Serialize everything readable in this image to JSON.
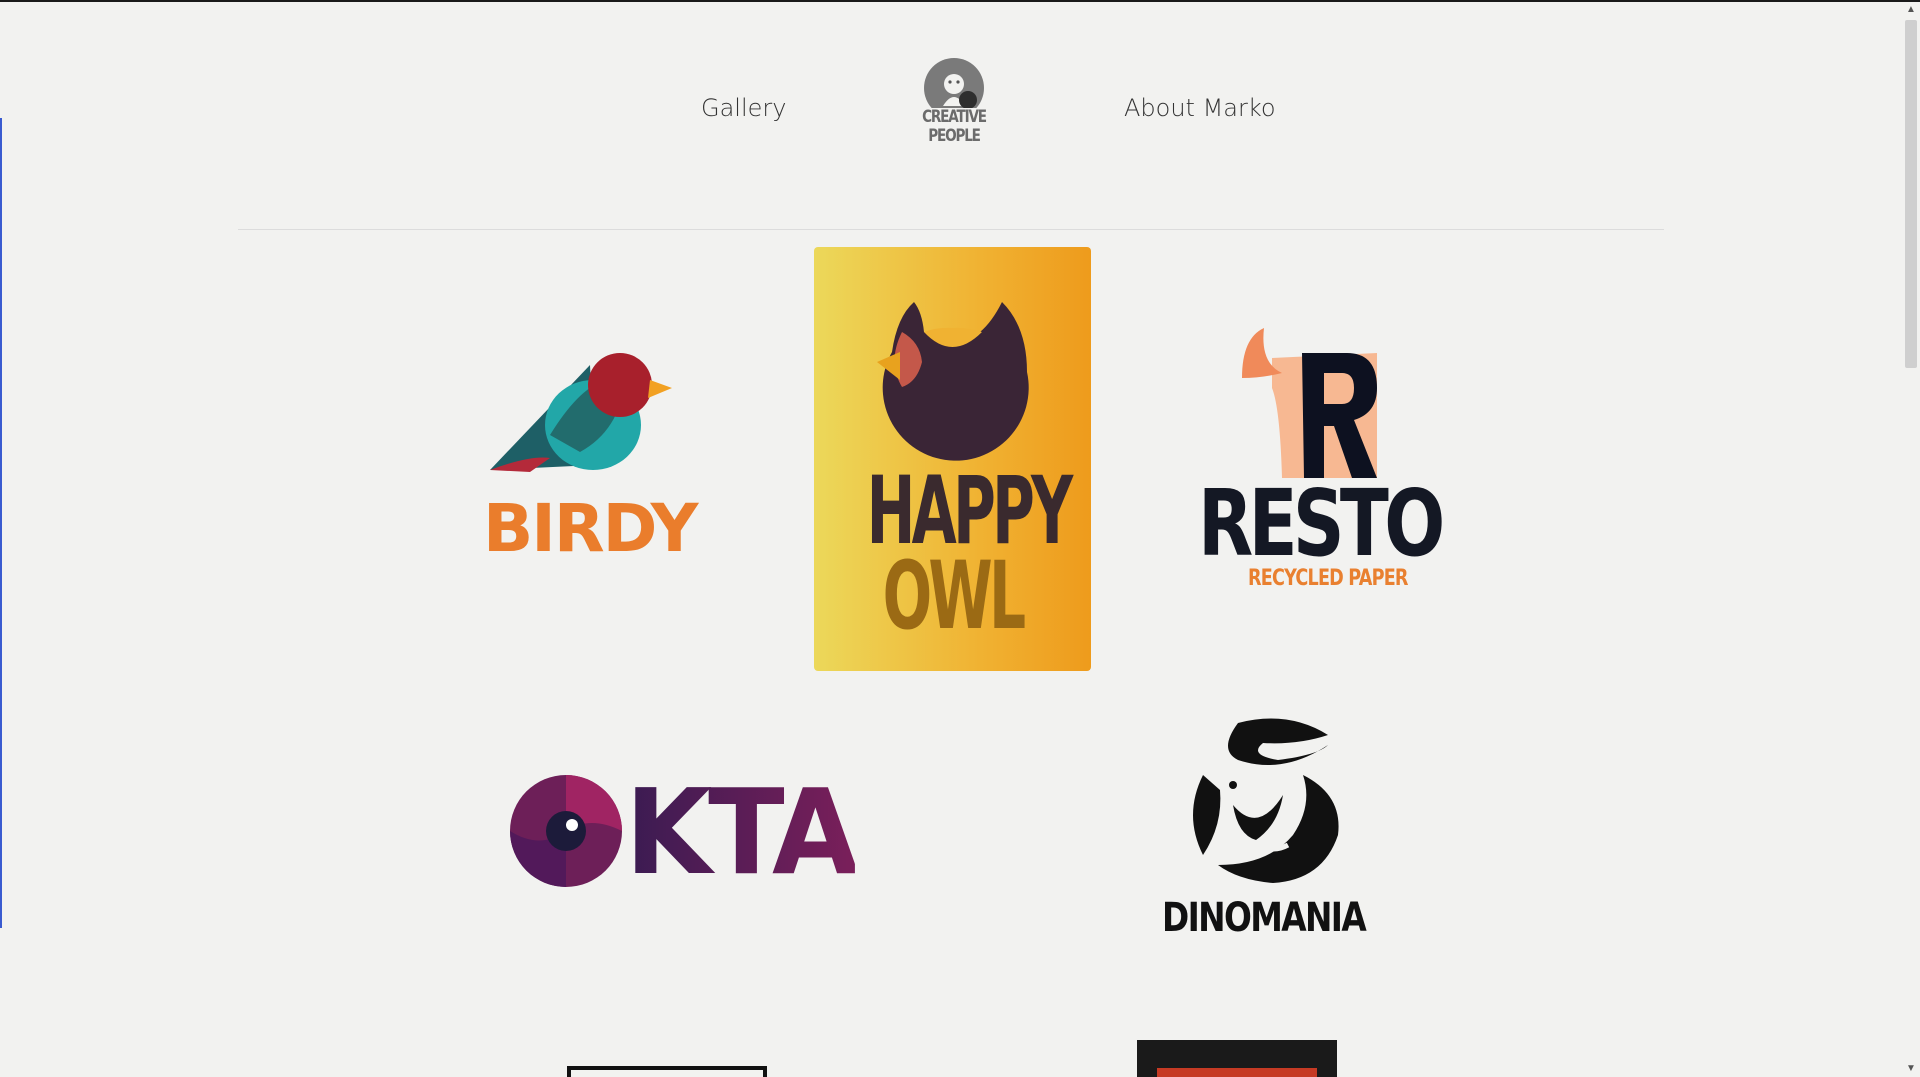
{
  "nav": {
    "gallery": "Gallery",
    "about": "About Marko",
    "brand": {
      "line1": "CREATIVE",
      "line2": "PEOPLE"
    }
  },
  "gallery": {
    "birdy": {
      "name": "BIRDY"
    },
    "happy_owl": {
      "line1": "HAPPY",
      "line2": "OWL"
    },
    "resto": {
      "name": "RESTO",
      "tagline": "RECYCLED PAPER"
    },
    "okta": {
      "name": "KTA"
    },
    "dinomania": {
      "name": "DINOMANIA"
    }
  },
  "colors": {
    "background": "#f2f2f0",
    "birdy_orange": "#ea7d2c",
    "owl_gradient_start": "#ecd85a",
    "owl_gradient_end": "#ee9b1c",
    "resto_navy": "#141824",
    "okta_purple": "#5a1f5a"
  }
}
